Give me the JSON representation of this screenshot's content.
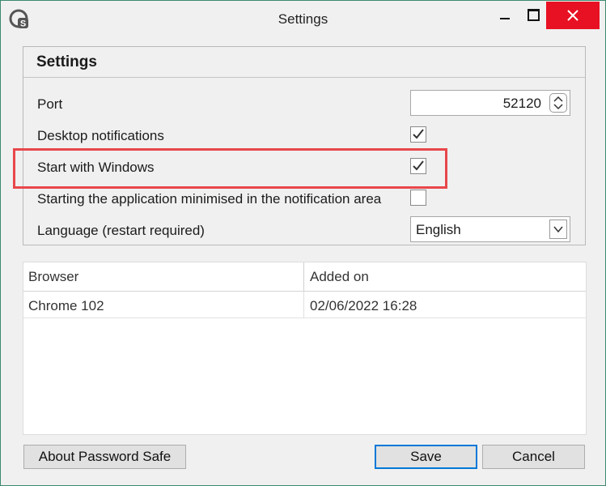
{
  "window": {
    "title": "Settings",
    "controls": {
      "minimize": "minimize-icon",
      "maximize": "maximize-icon",
      "close": "close-icon"
    }
  },
  "settings": {
    "header": "Settings",
    "port": {
      "label": "Port",
      "value": "52120"
    },
    "desktop_notifications": {
      "label": "Desktop notifications",
      "checked": true
    },
    "start_with_windows": {
      "label": "Start with Windows",
      "checked": true
    },
    "start_minimised": {
      "label": "Starting the application minimised in the notification area",
      "checked": false
    },
    "language": {
      "label": "Language (restart required)",
      "value": "English"
    }
  },
  "browsers_table": {
    "columns": [
      "Browser",
      "Added on"
    ],
    "rows": [
      [
        "Chrome 102",
        "02/06/2022 16:28"
      ]
    ]
  },
  "buttons": {
    "about": "About Password Safe",
    "save": "Save",
    "cancel": "Cancel"
  },
  "colors": {
    "close_button": "#e81123",
    "highlight": "#e8474b",
    "primary_focus": "#0078d7",
    "window_border": "#3c8a6e"
  }
}
